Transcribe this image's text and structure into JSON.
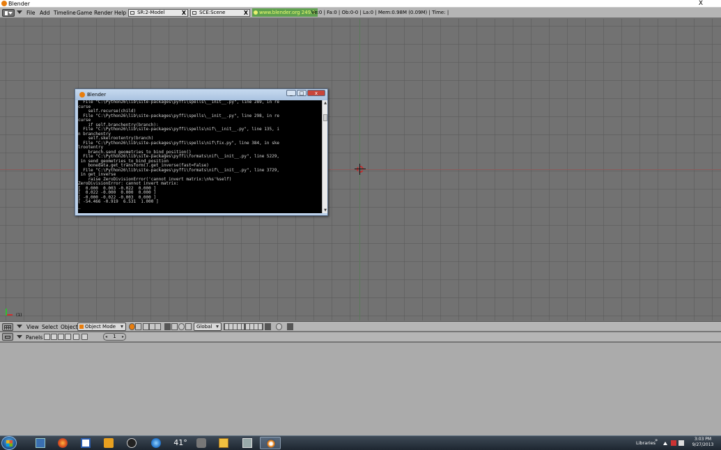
{
  "window": {
    "title": "Blender",
    "close_glyph": "X"
  },
  "info_header": {
    "menus": [
      "File",
      "Add",
      "Timeline",
      "Game",
      "Render",
      "Help"
    ],
    "screen_field": "SR:2-Model",
    "scene_field": "SCE:Scene",
    "field_close_glyph": "X",
    "version": "www.blender.org 249.2",
    "stats": "Ve:0 | Fa:0 | Ob:0-0 | La:0  | Mem:0.98M (0.09M)  | Time: |"
  },
  "viewport": {
    "frame_label": "(1)"
  },
  "console": {
    "title": "Blender",
    "lines": [
      "  File \"C:\\Python26\\lib\\site-packages\\pyffi\\spells\\__init__.py\", line 289, in re",
      "curse",
      "    self.recurse(child)",
      "  File \"C:\\Python26\\lib\\site-packages\\pyffi\\spells\\__init__.py\", line 298, in re",
      "curse",
      "    if self.branchentry(branch):",
      "  File \"C:\\Python26\\lib\\site-packages\\pyffi\\spells\\nif\\__init__.py\", line 135, i",
      "n branchentry",
      "    self.skelrootentry(branch)",
      "  File \"C:\\Python26\\lib\\site-packages\\pyffi\\spells\\nif\\fix.py\", line 384, in ske",
      "lrootentry",
      "    branch.send_geometries_to_bind_position()",
      "  File \"C:\\Python26\\lib\\site-packages\\pyffi\\formats\\nif\\__init__.py\", line 5229,",
      " in send_geometries_to_bind_position",
      "    bonedata.get_transform().get_inverse(fast=False)",
      "  File \"C:\\Python26\\lib\\site-packages\\pyffi\\formats\\nif\\__init__.py\", line 3729,",
      " in get_inverse",
      "    raise ZeroDivisionError('cannot invert matrix:\\n%s'%self)",
      "ZeroDivisionError: cannot invert matrix:",
      "[  0.000  0.003 -0.022  0.000 ]",
      "[  0.022 -0.000  0.000  0.000 ]",
      "[ -0.000 -0.022 -0.003  0.000 ]",
      "[ -54.466 -0.919  6.531  1.000 ]",
      "",
      "_"
    ],
    "btn_min": "_",
    "btn_max": "□",
    "btn_close": "x",
    "scroll_up": "▲",
    "scroll_down": "▼"
  },
  "view3d_header": {
    "menus": [
      "View",
      "Select",
      "Object"
    ],
    "mode": "Object Mode",
    "orientation": "Global"
  },
  "buttons_header": {
    "panels_label": "Panels",
    "page_number": "1",
    "prev_arrow": "◂",
    "next_arrow": "▸"
  },
  "taskbar": {
    "temperature": "41°",
    "libraries_label": "Libraries",
    "overflow_chevron": "»",
    "time": "3:03 PM",
    "date": "9/27/2013"
  },
  "colors": {
    "viewport_bg": "#727272",
    "header_bg": "#b5b5b5",
    "version_bg": "#5fa04f",
    "console_bg": "#000000",
    "console_text": "#d8d8d8",
    "taskbar_bg": "#1d2630"
  }
}
